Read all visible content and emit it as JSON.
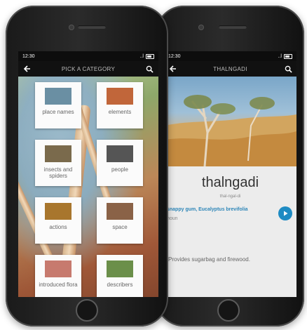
{
  "left_phone": {
    "status": {
      "time": "12:30",
      "signal": "..l"
    },
    "nav": {
      "title": "PICK A CATEGORY",
      "back_icon": "back-arrow-icon",
      "search_icon": "search-icon"
    },
    "categories": [
      {
        "label": "place names",
        "thumb_color": "#6a8fa3"
      },
      {
        "label": "elements",
        "thumb_color": "#c1663a"
      },
      {
        "label": "insects and spiders",
        "thumb_color": "#7a6a4c"
      },
      {
        "label": "people",
        "thumb_color": "#555555"
      },
      {
        "label": "actions",
        "thumb_color": "#a8762d"
      },
      {
        "label": "space",
        "thumb_color": "#8a6247"
      },
      {
        "label": "introduced flora",
        "thumb_color": "#c77a6e"
      },
      {
        "label": "describers",
        "thumb_color": "#6b8f4a"
      }
    ]
  },
  "right_phone": {
    "status": {
      "time": "12:30",
      "signal": "..l"
    },
    "nav": {
      "title": "THALNGADI",
      "back_icon": "back-arrow-icon",
      "search_icon": "search-icon"
    },
    "word": {
      "title": "thalngadi",
      "phonetic": "thal-ngal-di",
      "definition": "snappy gum, Eucalyptus brevifolia",
      "part_of_speech": "noun",
      "note": "Provides sugarbag and firewood."
    },
    "accent_color": "#1e8bc3"
  }
}
